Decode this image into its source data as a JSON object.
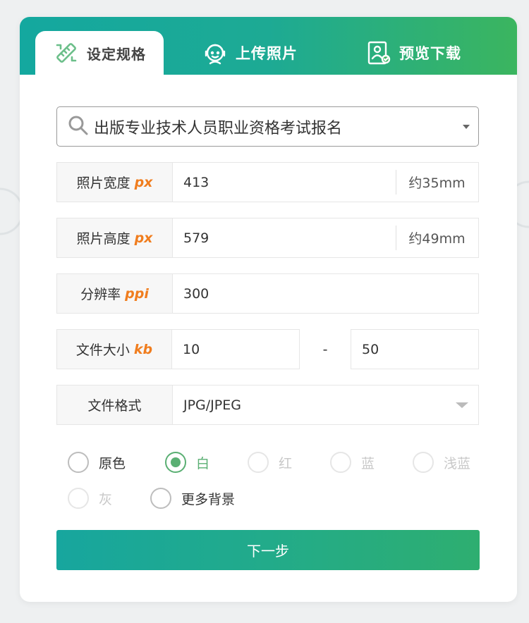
{
  "tabs": [
    {
      "label": "设定规格",
      "icon": "ruler-pencil-icon",
      "active": true
    },
    {
      "label": "上传照片",
      "icon": "person-headset-icon",
      "active": false
    },
    {
      "label": "预览下载",
      "icon": "portrait-check-icon",
      "active": false
    }
  ],
  "search": {
    "value": "出版专业技术人员职业资格考试报名",
    "icon": "search-icon"
  },
  "fields": {
    "width": {
      "label": "照片宽度",
      "unit_tag": "px",
      "value": "413",
      "approx": "约35mm"
    },
    "height": {
      "label": "照片高度",
      "unit_tag": "px",
      "value": "579",
      "approx": "约49mm"
    },
    "resolution": {
      "label": "分辨率",
      "unit_tag": "ppi",
      "value": "300"
    },
    "filesize": {
      "label": "文件大小",
      "unit_tag": "kb",
      "min": "10",
      "separator": "-",
      "max": "50"
    },
    "format": {
      "label": "文件格式",
      "value": "JPG/JPEG"
    }
  },
  "background_options": [
    {
      "label": "原色",
      "state": "enabled"
    },
    {
      "label": "白",
      "state": "checked"
    },
    {
      "label": "红",
      "state": "disabled"
    },
    {
      "label": "蓝",
      "state": "disabled"
    },
    {
      "label": "浅蓝",
      "state": "disabled"
    },
    {
      "label": "灰",
      "state": "disabled"
    },
    {
      "label": "更多背景",
      "state": "enabled"
    }
  ],
  "next_button": {
    "label": "下一步"
  },
  "colors": {
    "accent_green": "#5aaf73",
    "tag_orange": "#f07d1e",
    "header_gradient_start": "#14a89f",
    "header_gradient_end": "#3bb55f"
  }
}
